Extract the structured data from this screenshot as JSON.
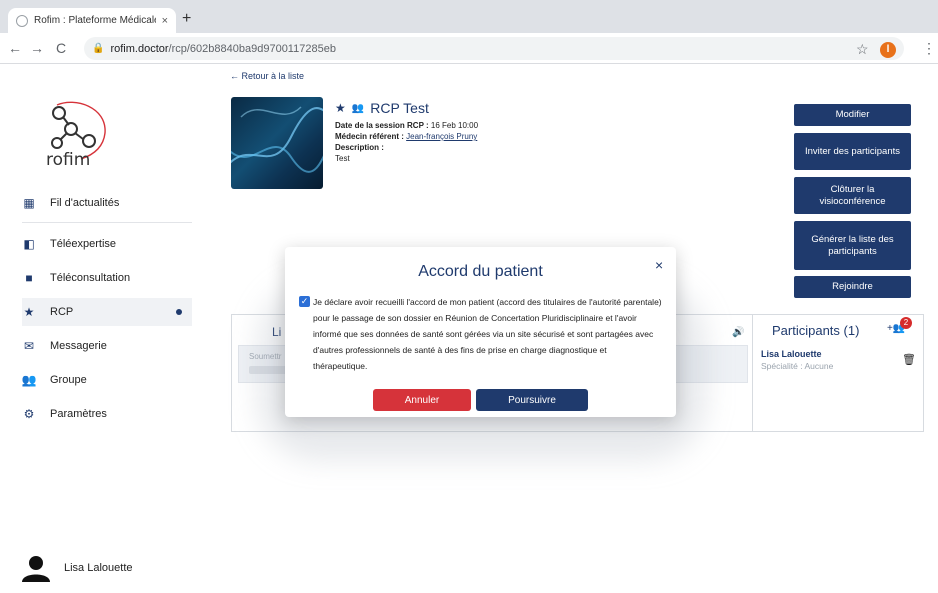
{
  "browser": {
    "tab_title": "Rofim : Plateforme Médicale, T",
    "tab_close": "×",
    "new_tab": "+",
    "url_host": "rofim.doctor",
    "url_path": "/rcp/602b8840ba9d9700117285eb",
    "profile_letter": "l"
  },
  "sidebar": {
    "logo_text": "rofim",
    "items": [
      {
        "label": "Fil d'actualités",
        "icon": "dashboard-icon"
      },
      {
        "label": "Téléexpertise",
        "icon": "expertise-icon"
      },
      {
        "label": "Téléconsultation",
        "icon": "video-icon"
      },
      {
        "label": "RCP",
        "icon": "star-icon"
      },
      {
        "label": "Messagerie",
        "icon": "mail-icon"
      },
      {
        "label": "Groupe",
        "icon": "group-icon"
      },
      {
        "label": "Paramètres",
        "icon": "gear-icon"
      }
    ],
    "user_name": "Lisa Lalouette"
  },
  "main": {
    "back_link": "← Retour à la liste",
    "title": "RCP Test",
    "session_label": "Date de la session RCP :",
    "session_value": "16 Feb 10:00",
    "doctor_label": "Médecin référent :",
    "doctor_value": "Jean-françois Pruny",
    "description_label": "Description :",
    "description_value": "Test",
    "buttons": {
      "modify": "Modifier",
      "invite": "Inviter des participants",
      "close_video": "Clôturer la visioconférence",
      "generate": "Générer la liste des participants",
      "join": "Rejoindre"
    },
    "panel": {
      "left_head": "Li",
      "submit_placeholder": "Soumettr",
      "participants_head": "Participants (1)",
      "participant_count_badge": "2",
      "participant_name": "Lisa Lalouette",
      "participant_spec": "Spécialité : Aucune"
    }
  },
  "modal": {
    "title": "Accord du patient",
    "close": "×",
    "text": "Je déclare avoir recueilli l'accord de mon patient (accord des titulaires de l'autorité parentale) pour le passage de son dossier en Réunion de Concertation Pluridisciplinaire et l'avoir informé que ses données de santé sont gérées via un site sécurisé et sont partagées avec d'autres professionnels de santé à des fins de prise en charge diagnostique et thérapeutique.",
    "checked": true,
    "cancel_label": "Annuler",
    "continue_label": "Poursuivre"
  },
  "colors": {
    "brand": "#1f3a6d",
    "danger": "#d6333a",
    "checkbox": "#2c6fd6"
  }
}
